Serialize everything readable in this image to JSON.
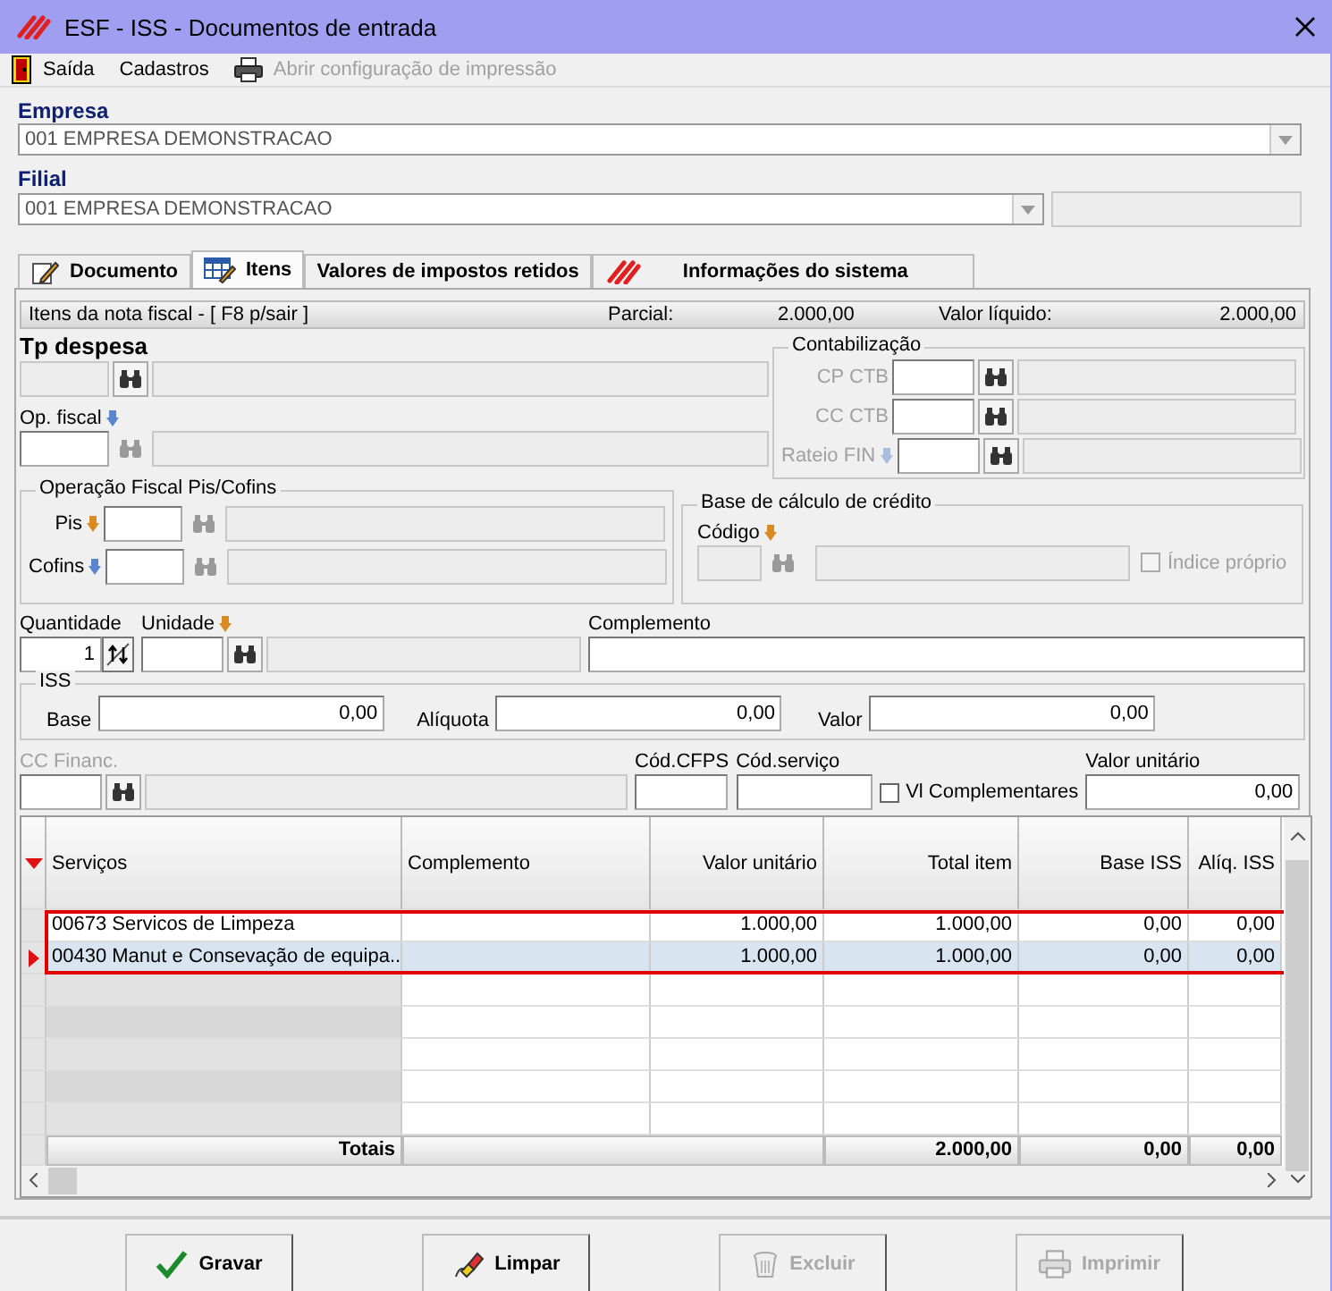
{
  "window": {
    "title": "ESF - ISS - Documentos de entrada"
  },
  "menu": [
    {
      "label": "Saída",
      "kind": "door",
      "disabled": false
    },
    {
      "label": "Cadastros",
      "kind": "plain",
      "disabled": false
    },
    {
      "label": "Abrir configuração de impressão",
      "kind": "printer",
      "disabled": true
    }
  ],
  "empresa": {
    "label": "Empresa",
    "value": "001 EMPRESA DEMONSTRACAO"
  },
  "filial": {
    "label": "Filial",
    "value": "001 EMPRESA DEMONSTRACAO"
  },
  "tabs": [
    {
      "label": "Documento",
      "kind": "pencil",
      "selected": false
    },
    {
      "label": "Itens",
      "kind": "table",
      "selected": true
    },
    {
      "label": "Valores de impostos retidos",
      "kind": "plain",
      "selected": false
    },
    {
      "label": "Informações do sistema",
      "kind": "logo",
      "selected": false
    }
  ],
  "panel_header": {
    "title": "Itens da nota fiscal - [ F8 p/sair ]",
    "parcial_label": "Parcial:",
    "parcial": "2.000,00",
    "liquido_label": "Valor líquido:",
    "liquido": "2.000,00"
  },
  "tp_despesa": {
    "label": "Tp despesa",
    "code": {
      "disabled": true
    },
    "lookup": {
      "disabled": false
    },
    "description": {
      "disabled": true
    }
  },
  "op_fiscal": {
    "label": "Op. fiscal",
    "marker": {
      "color": "#5a86d0"
    },
    "code": {
      "disabled": false
    },
    "lookup": {
      "disabled": true
    },
    "description": {
      "disabled": true
    }
  },
  "contabilizacao": {
    "title": "Contabilização",
    "rows": [
      {
        "label": "CP CTB",
        "label_disabled": true,
        "code": {
          "disabled": false
        },
        "lookup": {
          "disabled": false
        },
        "description": {
          "disabled": true
        }
      },
      {
        "label": "CC CTB",
        "label_disabled": true,
        "code": {
          "disabled": false
        },
        "lookup": {
          "disabled": false
        },
        "description": {
          "disabled": true
        }
      },
      {
        "label": "Rateio FIN",
        "label_disabled": true,
        "marker": {
          "color": "#a8bce0"
        },
        "code": {
          "disabled": false
        },
        "lookup": {
          "disabled": false
        },
        "description": {
          "disabled": true
        }
      }
    ]
  },
  "pis_cofins": {
    "title": "Operação Fiscal Pis/Cofins",
    "rows": [
      {
        "label": "Pis",
        "label_disabled": false,
        "marker": {
          "color": "#d98a20"
        },
        "code": {
          "disabled": false
        },
        "lookup": {
          "disabled": true
        },
        "description": {
          "disabled": true
        }
      },
      {
        "label": "Cofins",
        "label_disabled": false,
        "marker": {
          "color": "#5a86d0"
        },
        "code": {
          "disabled": false
        },
        "lookup": {
          "disabled": true
        },
        "description": {
          "disabled": true
        }
      }
    ]
  },
  "base_credito": {
    "title": "Base de cálculo de crédito",
    "label": "Código",
    "marker": {
      "color": "#d98a20"
    },
    "code": {
      "disabled": true
    },
    "lookup": {
      "disabled": true
    },
    "description": {
      "disabled": true
    },
    "indice_proprio": {
      "label": "Índice próprio",
      "checked": false,
      "disabled": true
    }
  },
  "quantidade": {
    "label": "Quantidade",
    "value": "1"
  },
  "unidade": {
    "label": "Unidade",
    "marker": {
      "color": "#d98a20"
    },
    "code": {
      "disabled": false
    },
    "lookup": {
      "disabled": false
    },
    "description": {
      "disabled": true
    }
  },
  "complemento": {
    "label": "Complemento"
  },
  "iss": {
    "title": "ISS",
    "fields": [
      {
        "label": "Base",
        "value": "0,00"
      },
      {
        "label": "Alíquota",
        "value": "0,00"
      },
      {
        "label": "Valor",
        "value": "0,00"
      }
    ]
  },
  "cc_financ": {
    "label": "CC Financ.",
    "label_disabled": true,
    "code": {
      "disabled": false
    },
    "lookup": {
      "disabled": false
    },
    "description": {
      "disabled": true
    }
  },
  "cod_cfps": {
    "label": "Cód.CFPS"
  },
  "cod_servico": {
    "label": "Cód.serviço"
  },
  "vl_complementares": {
    "label": "Vl Complementares",
    "checked": false
  },
  "valor_unitario": {
    "label": "Valor unitário",
    "value": "0,00"
  },
  "table": {
    "columns": [
      "Serviços",
      "Complemento",
      "Valor unitário",
      "Total item",
      "Base ISS",
      "Alíq. ISS"
    ],
    "highlight": true,
    "rows": [
      {
        "servico": "00673 Servicos de Limpeza",
        "valor_unitario": "1.000,00",
        "total_item": "1.000,00",
        "base_iss": "0,00",
        "aliq_iss": "0,00",
        "selected": false
      },
      {
        "servico": "00430 Manut e Consevação de equipa...",
        "valor_unitario": "1.000,00",
        "total_item": "1.000,00",
        "base_iss": "0,00",
        "aliq_iss": "0,00",
        "selected": true
      }
    ],
    "totals": {
      "label": "Totais",
      "total_item": "2.000,00",
      "base_iss": "0,00",
      "aliq_iss": "0,00"
    }
  },
  "buttons": [
    {
      "label": "Gravar",
      "kind": "check",
      "disabled": false
    },
    {
      "label": "Limpar",
      "kind": "eraser",
      "disabled": false
    },
    {
      "label": "Excluir",
      "kind": "trash",
      "disabled": true
    },
    {
      "label": "Imprimir",
      "kind": "printer",
      "disabled": true
    }
  ]
}
